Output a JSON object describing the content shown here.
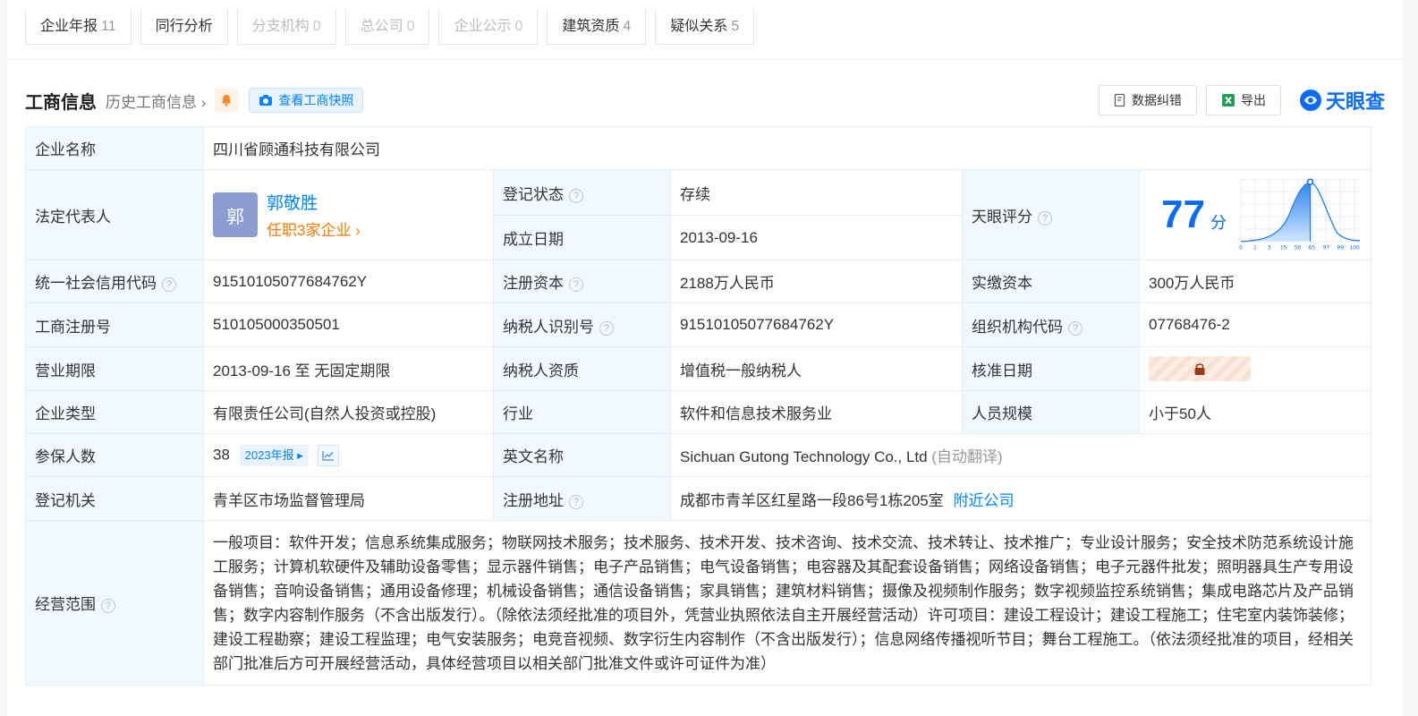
{
  "tabs": [
    {
      "label": "企业年报",
      "count": "11",
      "disabled": false
    },
    {
      "label": "同行分析",
      "count": "",
      "disabled": false
    },
    {
      "label": "分支机构",
      "count": "0",
      "disabled": true
    },
    {
      "label": "总公司",
      "count": "0",
      "disabled": true
    },
    {
      "label": "企业公示",
      "count": "0",
      "disabled": true
    },
    {
      "label": "建筑资质",
      "count": "4",
      "disabled": false
    },
    {
      "label": "疑似关系",
      "count": "5",
      "disabled": false
    }
  ],
  "header": {
    "title": "工商信息",
    "history_link": "历史工商信息",
    "snapshot_button": "查看工商快照",
    "correct_button": "数据纠错",
    "export_button": "导出",
    "logo_text": "天眼查"
  },
  "info": {
    "company_name_label": "企业名称",
    "company_name": "四川省顾通科技有限公司",
    "legal_rep_label": "法定代表人",
    "legal_rep_avatar": "郭",
    "legal_rep_name": "郭敬胜",
    "legal_rep_positions": "任职3家企业",
    "reg_status_label": "登记状态",
    "reg_status": "存续",
    "founded_label": "成立日期",
    "founded": "2013-09-16",
    "score_label": "天眼评分",
    "score": "77",
    "score_unit": "分",
    "score_axis": [
      "0",
      "1",
      "3",
      "15",
      "50",
      "65",
      "97",
      "99",
      "100"
    ],
    "credit_code_label": "统一社会信用代码",
    "credit_code": "91510105077684762Y",
    "reg_capital_label": "注册资本",
    "reg_capital": "2188万人民币",
    "paid_capital_label": "实缴资本",
    "paid_capital": "300万人民币",
    "reg_no_label": "工商注册号",
    "reg_no": "510105000350501",
    "taxpayer_id_label": "纳税人识别号",
    "taxpayer_id": "91510105077684762Y",
    "org_code_label": "组织机构代码",
    "org_code": "07768476-2",
    "term_label": "营业期限",
    "term": "2013-09-16 至 无固定期限",
    "taxpayer_qual_label": "纳税人资质",
    "taxpayer_qual": "增值税一般纳税人",
    "approval_date_label": "核准日期",
    "type_label": "企业类型",
    "type": "有限责任公司(自然人投资或控股)",
    "industry_label": "行业",
    "industry": "软件和信息技术服务业",
    "staff_label": "人员规模",
    "staff": "小于50人",
    "insured_label": "参保人数",
    "insured": "38",
    "insured_year": "2023年报",
    "english_name_label": "英文名称",
    "english_name": "Sichuan Gutong Technology Co., Ltd",
    "english_name_note": "(自动翻译)",
    "authority_label": "登记机关",
    "authority": "青羊区市场监督管理局",
    "address_label": "注册地址",
    "address": "成都市青羊区红星路一段86号1栋205室",
    "nearby_link": "附近公司",
    "scope_label": "经营范围",
    "scope": "一般项目：软件开发；信息系统集成服务；物联网技术服务；技术服务、技术开发、技术咨询、技术交流、技术转让、技术推广；专业设计服务；安全技术防范系统设计施工服务；计算机软硬件及辅助设备零售；显示器件销售；电子产品销售；电气设备销售；电容器及其配套设备销售；网络设备销售；电子元器件批发；照明器具生产专用设备销售；音响设备销售；通用设备修理；机械设备销售；通信设备销售；家具销售；建筑材料销售；摄像及视频制作服务；数字视频监控系统销售；集成电路芯片及产品销售；数字内容制作服务（不含出版发行）。（除依法须经批准的项目外，凭营业执照依法自主开展经营活动）许可项目：建设工程设计；建设工程施工；住宅室内装饰装修；建设工程勘察；建设工程监理；电气安装服务；电竞音视频、数字衍生内容制作（不含出版发行）；信息网络传播视听节目；舞台工程施工。（依法须经批准的项目，经相关部门批准后方可开展经营活动，具体经营项目以相关部门批准文件或许可证件为准）"
  },
  "colors": {
    "accent": "#0084ff",
    "status_green": "#17b26a",
    "label_bg": "#f2f8ff",
    "orange": "#ff7a00"
  }
}
